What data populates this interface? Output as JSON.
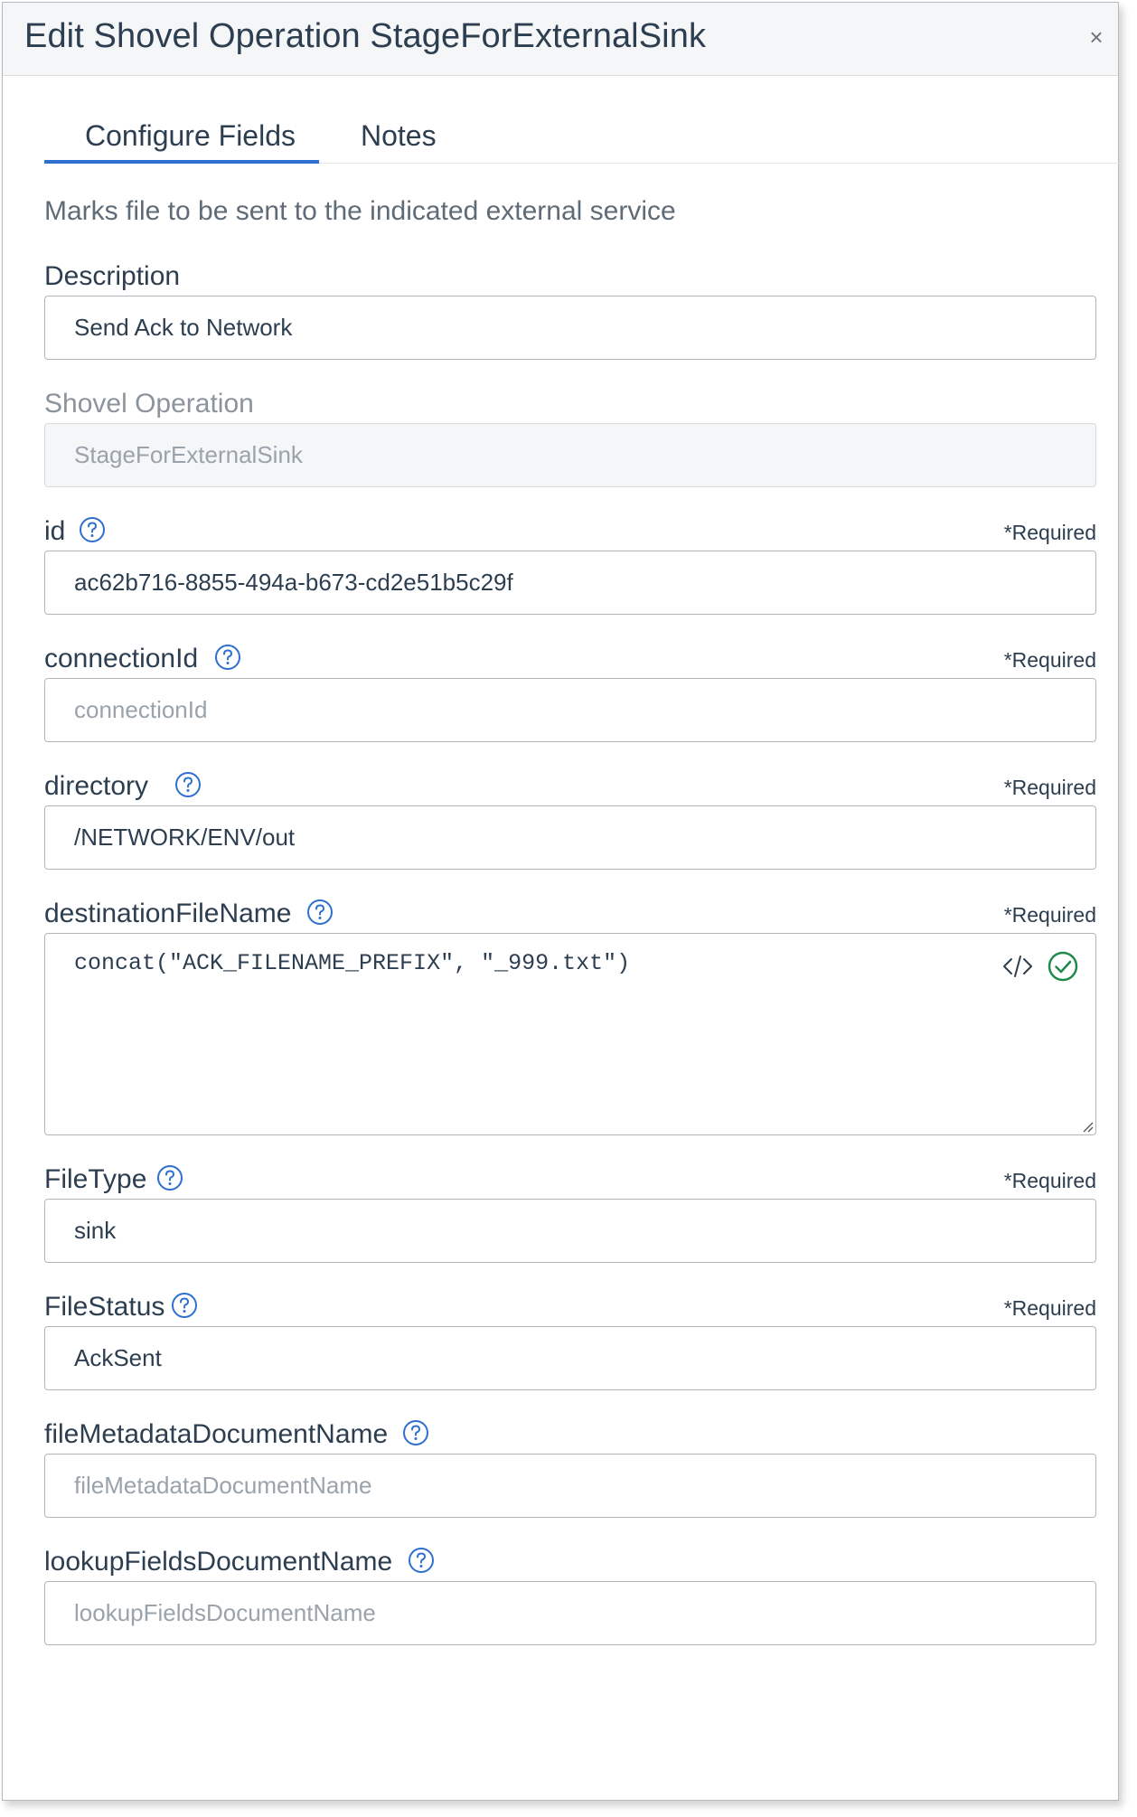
{
  "modal": {
    "title": "Edit Shovel Operation StageForExternalSink",
    "close_label": "×"
  },
  "tabs": [
    {
      "label": "Configure Fields",
      "active": true
    },
    {
      "label": "Notes",
      "active": false
    }
  ],
  "description_text": "Marks file to be sent to the indicated external service",
  "required_label": "*Required",
  "fields": {
    "description": {
      "label": "Description",
      "value": "Send Ack to Network"
    },
    "shovel_operation": {
      "label": "Shovel Operation",
      "placeholder": "StageForExternalSink",
      "disabled": true
    },
    "id": {
      "label": "id",
      "value": "ac62b716-8855-494a-b673-cd2e51b5c29f",
      "required": true
    },
    "connectionId": {
      "label": "connectionId",
      "placeholder": "connectionId",
      "required": true
    },
    "directory": {
      "label": "directory",
      "value": "/NETWORK/ENV/out",
      "required": true
    },
    "destinationFileName": {
      "label": "destinationFileName",
      "value": "concat(\"ACK_FILENAME_PREFIX\", \"_999.txt\")",
      "required": true
    },
    "FileType": {
      "label": "FileType",
      "value": "sink",
      "required": true
    },
    "FileStatus": {
      "label": "FileStatus",
      "value": "AckSent",
      "required": true
    },
    "fileMetadataDocumentName": {
      "label": "fileMetadataDocumentName",
      "placeholder": "fileMetadataDocumentName"
    },
    "lookupFieldsDocumentName": {
      "label": "lookupFieldsDocumentName",
      "placeholder": "lookupFieldsDocumentName"
    }
  },
  "colors": {
    "accent": "#2f6fd0",
    "valid_green": "#1f8a4c",
    "text": "#2c3e50"
  },
  "icons": {
    "help": "question-circle-icon",
    "code": "code-icon",
    "valid": "check-circle-icon",
    "close": "close-icon"
  }
}
